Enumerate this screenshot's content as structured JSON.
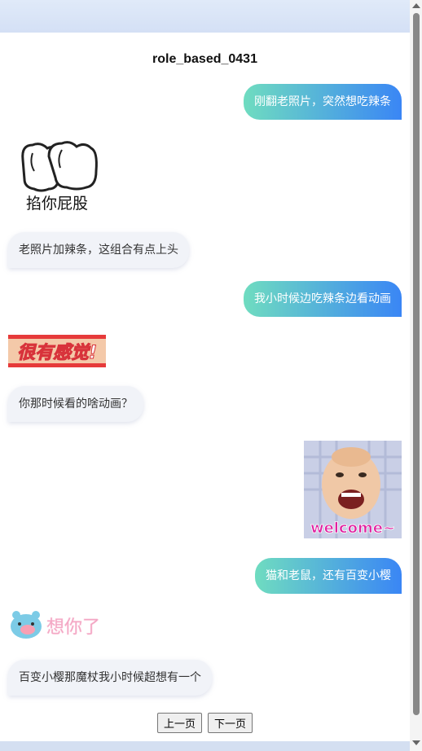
{
  "page": {
    "title": "role_based_0431"
  },
  "messages": [
    {
      "role": "user",
      "text": "刚翻老照片，突然想吃辣条"
    },
    {
      "role": "bot-sticker",
      "caption": "掐你屁股"
    },
    {
      "role": "bot",
      "text": "老照片加辣条，这组合有点上头"
    },
    {
      "role": "user",
      "text": "我小时候边吃辣条边看动画"
    },
    {
      "role": "bot-sticker",
      "caption": "很有感觉!"
    },
    {
      "role": "bot",
      "text": "你那时候看的啥动画？"
    },
    {
      "role": "user-sticker",
      "caption": "welcome~"
    },
    {
      "role": "user",
      "text": "猫和老鼠，还有百变小樱"
    },
    {
      "role": "bot-sticker",
      "caption": "想你了"
    },
    {
      "role": "bot",
      "text": "百变小樱那魔杖我小时候超想有一个"
    }
  ],
  "pager": {
    "prev": "上一页",
    "next": "下一页"
  },
  "colors": {
    "user_gradient_start": "#6fdcc0",
    "user_gradient_end": "#3a86f5",
    "bot_bubble": "#f1f3f8"
  }
}
